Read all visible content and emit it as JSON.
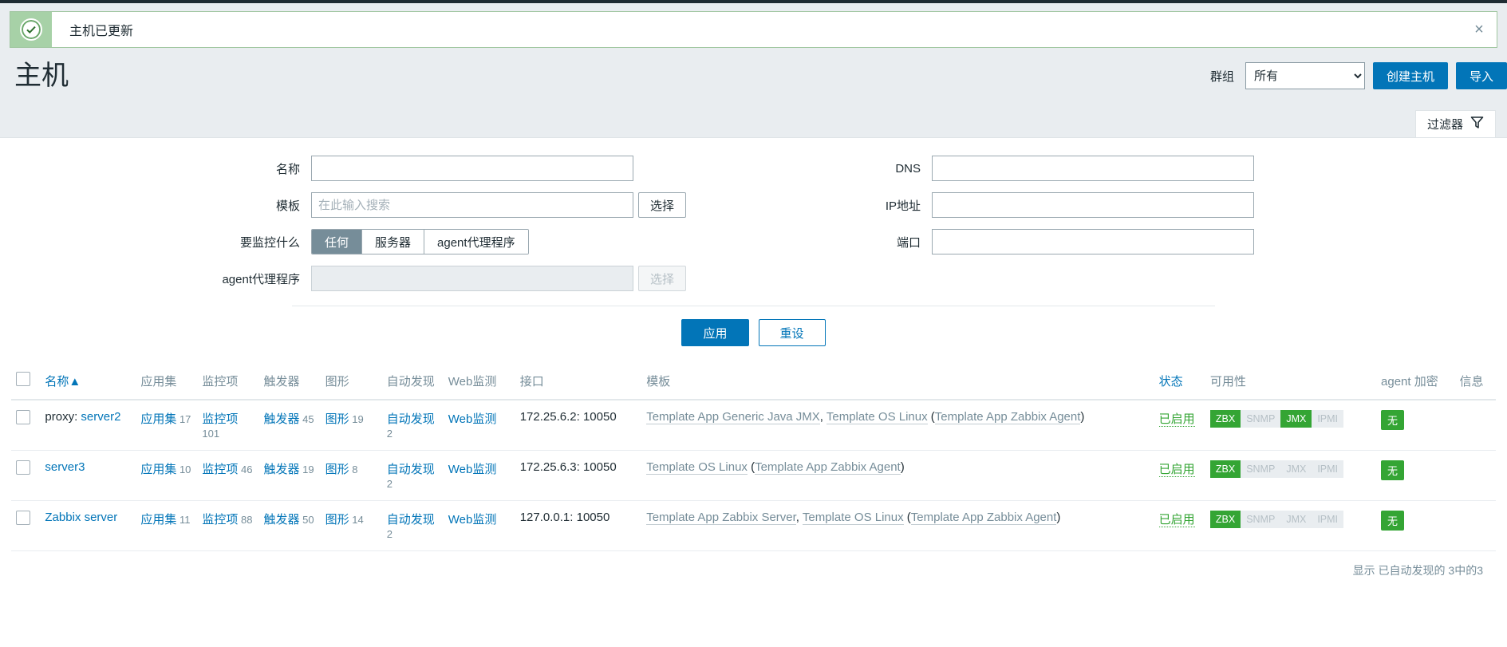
{
  "message_bar": {
    "text": "主机已更新",
    "icon": "check-circle-icon",
    "close_label": "×",
    "bg_color": "#a7d1a7"
  },
  "header": {
    "title": "主机",
    "group_label": "群组",
    "group_value": "所有",
    "group_options": [
      "所有"
    ],
    "create_host_label": "创建主机",
    "import_label": "导入"
  },
  "filter_tab": {
    "label": "过滤器",
    "icon": "funnel-icon"
  },
  "filter": {
    "name_label": "名称",
    "name_value": "",
    "template_label": "模板",
    "template_value": "",
    "template_placeholder": "在此输入搜索",
    "template_select_label": "选择",
    "monitored_by_label": "要监控什么",
    "monitored_by_options": [
      "任何",
      "服务器",
      "agent代理程序"
    ],
    "monitored_by_selected": "任何",
    "proxy_label": "agent代理程序",
    "proxy_value": "",
    "proxy_select_label": "选择",
    "dns_label": "DNS",
    "dns_value": "",
    "ip_label": "IP地址",
    "ip_value": "",
    "port_label": "端口",
    "port_value": "",
    "apply_label": "应用",
    "reset_label": "重设"
  },
  "table": {
    "headers": {
      "name": "名称",
      "sort_arrow": "▲",
      "applications": "应用集",
      "items": "监控项",
      "triggers": "触发器",
      "graphs": "图形",
      "discovery": "自动发现",
      "web": "Web监测",
      "interface": "接口",
      "templates": "模板",
      "status": "状态",
      "availability": "可用性",
      "encryption": "agent 加密",
      "info": "信息"
    },
    "rows": [
      {
        "name_prefix": "proxy: ",
        "name": "server2",
        "applications_label": "应用集",
        "applications_count": "17",
        "items_label": "监控项",
        "items_count": "101",
        "triggers_label": "触发器",
        "triggers_count": "45",
        "graphs_label": "图形",
        "graphs_count": "19",
        "discovery_label": "自动发现",
        "discovery_count": "2",
        "web_label": "Web监测",
        "interface": "172.25.6.2: 10050",
        "templates_text": "Template App Generic Java JMX, Template OS Linux (Template App Zabbix Agent)",
        "templates": [
          {
            "text": "Template App Generic Java JMX",
            "link": true
          },
          {
            "text": ", ",
            "link": false
          },
          {
            "text": "Template OS Linux",
            "link": true
          },
          {
            "text": " (",
            "link": false
          },
          {
            "text": "Template App Zabbix Agent",
            "link": true
          },
          {
            "text": ")",
            "link": false
          }
        ],
        "status": "已启用",
        "availability": [
          {
            "label": "ZBX",
            "active": true
          },
          {
            "label": "SNMP",
            "active": false
          },
          {
            "label": "JMX",
            "active": true
          },
          {
            "label": "IPMI",
            "active": false
          }
        ],
        "encryption": "无",
        "info": ""
      },
      {
        "name_prefix": "",
        "name": "server3",
        "applications_label": "应用集",
        "applications_count": "10",
        "items_label": "监控项",
        "items_count": "46",
        "triggers_label": "触发器",
        "triggers_count": "19",
        "graphs_label": "图形",
        "graphs_count": "8",
        "discovery_label": "自动发现",
        "discovery_count": "2",
        "web_label": "Web监测",
        "interface": "172.25.6.3: 10050",
        "templates_text": "Template OS Linux (Template App Zabbix Agent)",
        "templates": [
          {
            "text": "Template OS Linux",
            "link": true
          },
          {
            "text": " (",
            "link": false
          },
          {
            "text": "Template App Zabbix Agent",
            "link": true
          },
          {
            "text": ")",
            "link": false
          }
        ],
        "status": "已启用",
        "availability": [
          {
            "label": "ZBX",
            "active": true
          },
          {
            "label": "SNMP",
            "active": false
          },
          {
            "label": "JMX",
            "active": false
          },
          {
            "label": "IPMI",
            "active": false
          }
        ],
        "encryption": "无",
        "info": ""
      },
      {
        "name_prefix": "",
        "name": "Zabbix server",
        "applications_label": "应用集",
        "applications_count": "11",
        "items_label": "监控项",
        "items_count": "88",
        "triggers_label": "触发器",
        "triggers_count": "50",
        "graphs_label": "图形",
        "graphs_count": "14",
        "discovery_label": "自动发现",
        "discovery_count": "2",
        "web_label": "Web监测",
        "interface": "127.0.0.1: 10050",
        "templates_text": "Template App Zabbix Server, Template OS Linux (Template App Zabbix Agent)",
        "templates": [
          {
            "text": "Template App Zabbix Server",
            "link": true
          },
          {
            "text": ", ",
            "link": false
          },
          {
            "text": "Template OS Linux",
            "link": true
          },
          {
            "text": " (",
            "link": false
          },
          {
            "text": "Template App Zabbix Agent",
            "link": true
          },
          {
            "text": ")",
            "link": false
          }
        ],
        "status": "已启用",
        "availability": [
          {
            "label": "ZBX",
            "active": true
          },
          {
            "label": "SNMP",
            "active": false
          },
          {
            "label": "JMX",
            "active": false
          },
          {
            "label": "IPMI",
            "active": false
          }
        ],
        "encryption": "无",
        "info": ""
      }
    ],
    "footer": "显示 已自动发现的 3中的3"
  },
  "colors": {
    "accent": "#0275b8",
    "success": "#34a534",
    "muted": "#768d99",
    "page_bg": "#e9edf0"
  }
}
